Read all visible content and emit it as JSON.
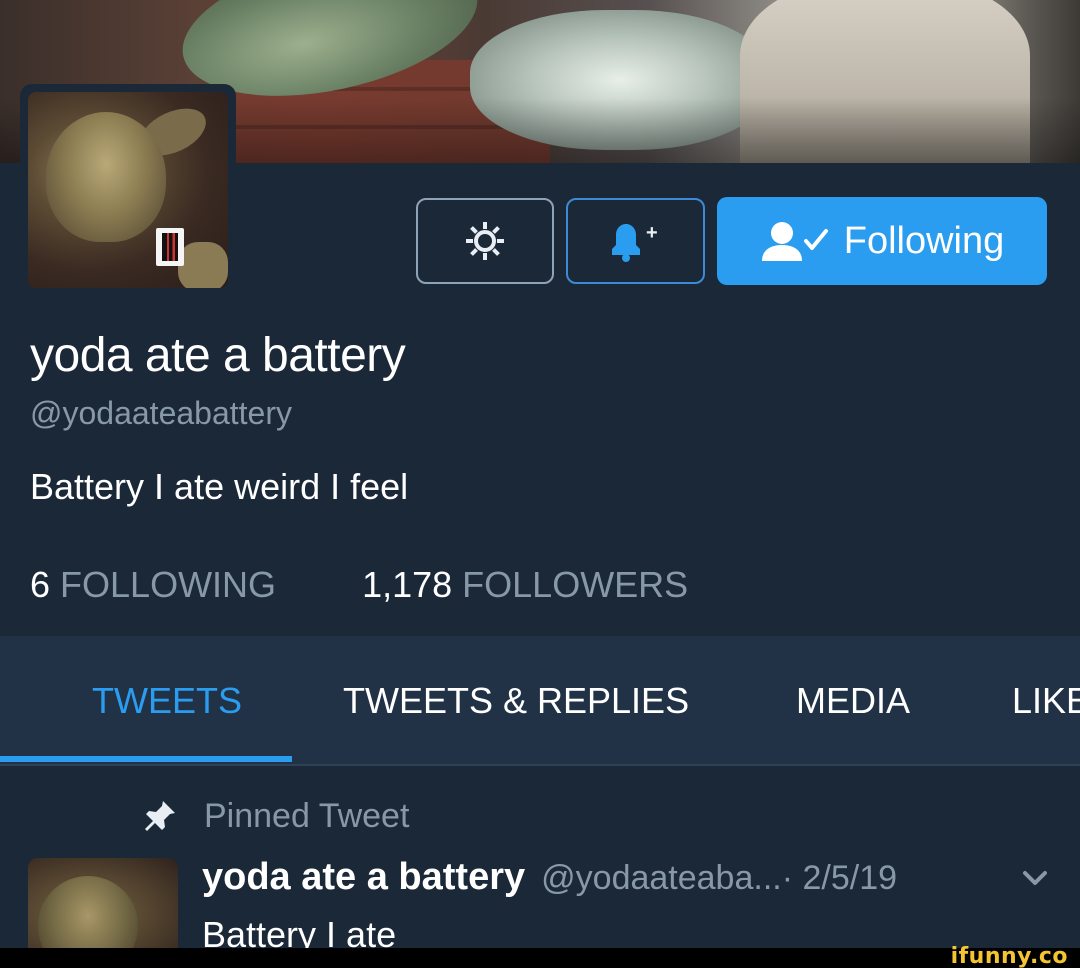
{
  "profile": {
    "name": "yoda ate a battery",
    "handle": "@yodaateabattery",
    "bio": "Battery I ate weird I feel"
  },
  "actions": {
    "settings_icon": "gear-icon",
    "notify_icon": "bell-plus-icon",
    "follow_icon": "user-check-icon",
    "follow_label": "Following"
  },
  "stats": {
    "following_count": "6",
    "following_label": "FOLLOWING",
    "followers_count": "1,178",
    "followers_label": "FOLLOWERS"
  },
  "tabs": [
    {
      "label": "TWEETS",
      "active": true
    },
    {
      "label": "TWEETS & REPLIES",
      "active": false
    },
    {
      "label": "MEDIA",
      "active": false
    },
    {
      "label": "LIKE",
      "active": false
    }
  ],
  "pinned_tweet": {
    "pinned_label": "Pinned Tweet",
    "author_name": "yoda ate a battery",
    "author_handle": "@yodaateaba...",
    "date": " · 2/5/19",
    "text": "Battery I ate"
  },
  "colors": {
    "background": "#1b2838",
    "accent": "#2a9df0",
    "muted_text": "#8899a6"
  },
  "watermark": "ifunny.co"
}
